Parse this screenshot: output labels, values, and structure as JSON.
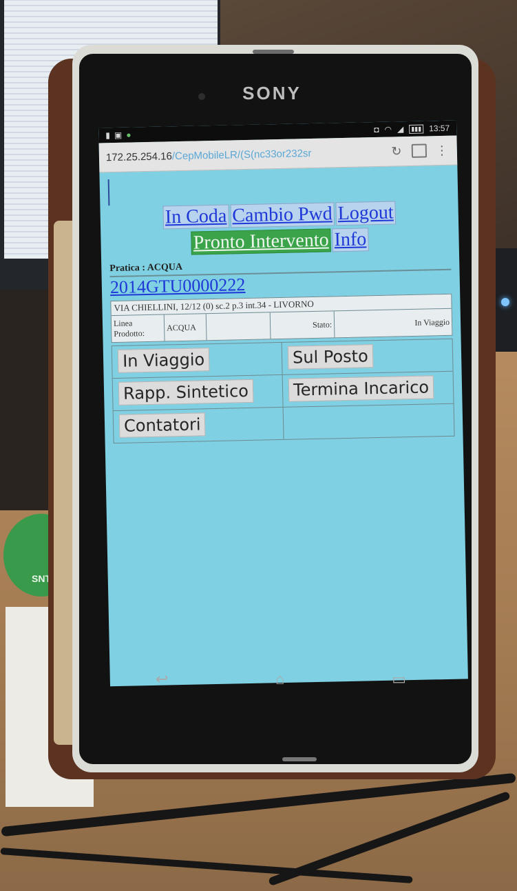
{
  "device": {
    "brand": "SONY",
    "status_time": "13:57"
  },
  "browser": {
    "url_host": "172.25.254.16",
    "url_path": "/CepMobileLR/(S(nc33or232sr"
  },
  "nav": {
    "row1": [
      "In Coda",
      "Cambio Pwd",
      "Logout"
    ],
    "row2_active": "Pronto Intervento",
    "row2_info": "Info"
  },
  "pratica": {
    "label": "Pratica : ACQUA",
    "code": "2014GTU0000222",
    "address": "VIA CHIELLINI, 12/12 (0) sc.2 p.3 int.34 - LIVORNO",
    "linea_label": "Linea Prodotto:",
    "linea_value": "ACQUA",
    "stato_label": "Stato:",
    "stato_value": "In Viaggio"
  },
  "actions": {
    "in_viaggio": "In Viaggio",
    "sul_posto": "Sul Posto",
    "rapp_sintetico": "Rapp. Sintetico",
    "termina_incarico": "Termina Incarico",
    "contatori": "Contatori"
  },
  "scene": {
    "sticker_text": "SNT"
  }
}
